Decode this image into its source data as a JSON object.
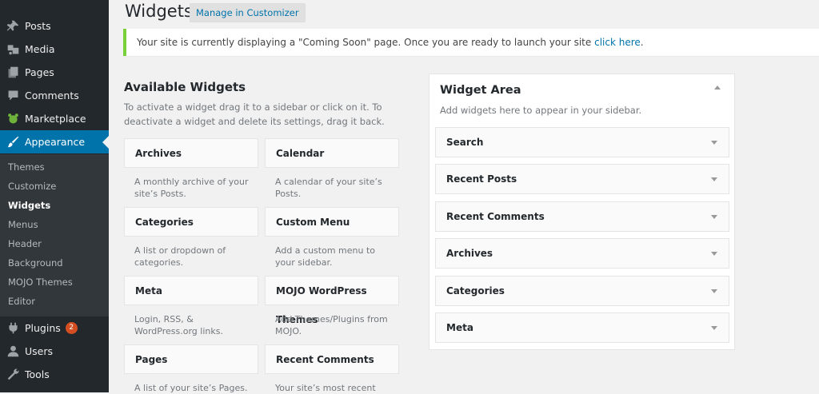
{
  "sidebar": {
    "items": [
      {
        "label": "Posts",
        "icon": "pushpin-icon"
      },
      {
        "label": "Media",
        "icon": "media-icon"
      },
      {
        "label": "Pages",
        "icon": "pages-icon"
      },
      {
        "label": "Comments",
        "icon": "comments-icon"
      },
      {
        "label": "Marketplace",
        "icon": "marketplace-icon"
      },
      {
        "label": "Appearance",
        "icon": "paintbrush-icon"
      },
      {
        "label": "Plugins",
        "icon": "plugins-icon",
        "badge": "2"
      },
      {
        "label": "Users",
        "icon": "users-icon"
      },
      {
        "label": "Tools",
        "icon": "wrench-icon"
      }
    ],
    "submenu": [
      "Themes",
      "Customize",
      "Widgets",
      "Menus",
      "Header",
      "Background",
      "MOJO Themes",
      "Editor"
    ],
    "active_color": "#0073aa"
  },
  "header": {
    "title": "Widgets",
    "customizer_label": "Manage in Customizer"
  },
  "notice": {
    "text": "Your site is currently displaying a \"Coming Soon\" page. Once you are ready to launch your site ",
    "link": "click here",
    "suffix": ".",
    "border_color": "#7ad03a"
  },
  "available": {
    "title": "Available Widgets",
    "description": "To activate a widget drag it to a sidebar or click on it. To deactivate a widget and delete its settings, drag it back.",
    "widgets": [
      {
        "name": "Archives",
        "desc": "A monthly archive of your site’s Posts."
      },
      {
        "name": "Calendar",
        "desc": "A calendar of your site’s Posts."
      },
      {
        "name": "Categories",
        "desc": "A list or dropdown of categories."
      },
      {
        "name": "Custom Menu",
        "desc": "Add a custom menu to your sidebar."
      },
      {
        "name": "Meta",
        "desc": "Login, RSS, & WordPress.org links."
      },
      {
        "name": "MOJO WordPress Themes",
        "desc": "Add Themes/Plugins from MOJO."
      },
      {
        "name": "Pages",
        "desc": "A list of your site’s Pages."
      },
      {
        "name": "Recent Comments",
        "desc": "Your site’s most recent"
      }
    ]
  },
  "widget_area": {
    "title": "Widget Area",
    "description": "Add widgets here to appear in your sidebar.",
    "widgets": [
      "Search",
      "Recent Posts",
      "Recent Comments",
      "Archives",
      "Categories",
      "Meta"
    ]
  }
}
